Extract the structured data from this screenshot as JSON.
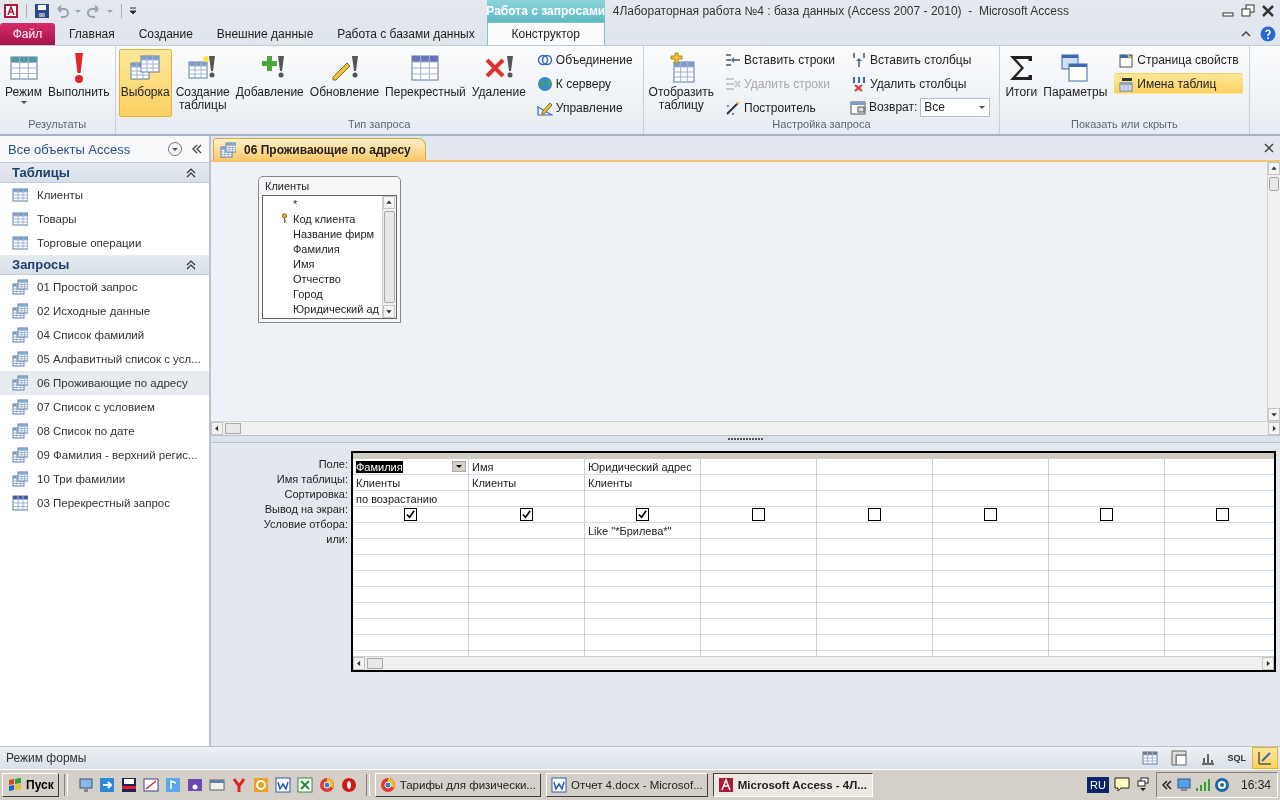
{
  "window": {
    "title": "4Лабораторная работа №4 : база данных (Access 2007 - 2010)  -  Microsoft Access"
  },
  "contextual_tab": "Работа с запросами",
  "tabs": [
    {
      "label": "Файл",
      "kind": "file",
      "selected": false
    },
    {
      "label": "Главная",
      "kind": "normal",
      "selected": false
    },
    {
      "label": "Создание",
      "kind": "normal",
      "selected": false
    },
    {
      "label": "Внешние данные",
      "kind": "normal",
      "selected": false
    },
    {
      "label": "Работа с базами данных",
      "kind": "normal",
      "selected": false
    },
    {
      "label": "Конструктор",
      "kind": "contextual",
      "selected": true
    }
  ],
  "ribbon_groups": [
    {
      "label": "Результаты",
      "columns": [
        [
          {
            "label": "Режим",
            "kind": "large",
            "menu": true,
            "selected": false
          }
        ],
        [
          {
            "label": "Выполнить",
            "kind": "large",
            "selected": false
          }
        ]
      ]
    },
    {
      "label": "Тип запроса",
      "columns": [
        [
          {
            "label": "Выборка",
            "kind": "large",
            "selected": true
          }
        ],
        [
          {
            "label": "Создание\nтаблицы",
            "kind": "large",
            "selected": false
          }
        ],
        [
          {
            "label": "Добавление",
            "kind": "large",
            "selected": false
          }
        ],
        [
          {
            "label": "Обновление",
            "kind": "large",
            "selected": false
          }
        ],
        [
          {
            "label": "Перекрестный",
            "kind": "large",
            "selected": false
          }
        ],
        [
          {
            "label": "Удаление",
            "kind": "large",
            "selected": false
          }
        ],
        [
          {
            "label": "Объединение",
            "kind": "small",
            "selected": false,
            "disabled": false
          },
          {
            "label": "К серверу",
            "kind": "small",
            "selected": false,
            "disabled": false
          },
          {
            "label": "Управление",
            "kind": "small",
            "selected": false,
            "disabled": false
          }
        ]
      ]
    },
    {
      "label": "Настройка запроса",
      "columns": [
        [
          {
            "label": "Отобразить\nтаблицу",
            "kind": "large",
            "selected": false
          }
        ],
        [
          {
            "label": "Вставить строки",
            "kind": "small",
            "selected": false,
            "disabled": false
          },
          {
            "label": "Удалить строки",
            "kind": "small",
            "selected": false,
            "disabled": true
          },
          {
            "label": "Построитель",
            "kind": "small",
            "selected": false,
            "disabled": false
          }
        ],
        [
          {
            "label": "Вставить столбцы",
            "kind": "small",
            "selected": false,
            "disabled": false
          },
          {
            "label": "Удалить столбцы",
            "kind": "small",
            "selected": false,
            "disabled": false
          },
          {
            "label": "Возврат:",
            "kind": "combo",
            "value": "Все"
          }
        ]
      ]
    },
    {
      "label": "Показать или скрыть",
      "columns": [
        [
          {
            "label": "Итоги",
            "kind": "large",
            "selected": false
          }
        ],
        [
          {
            "label": "Параметры",
            "kind": "large",
            "selected": false
          }
        ],
        [
          {
            "label": "Страница свойств",
            "kind": "small",
            "selected": false,
            "disabled": false
          },
          {
            "label": "Имена таблиц",
            "kind": "small",
            "selected": true,
            "disabled": false
          }
        ]
      ]
    }
  ],
  "navigation": {
    "title": "Все объекты Access",
    "sections": [
      {
        "title": "Таблицы",
        "expanded": true,
        "items": [
          {
            "label": "Клиенты",
            "kind": "table",
            "selected": false
          },
          {
            "label": "Товары",
            "kind": "table",
            "selected": false
          },
          {
            "label": "Торговые операции",
            "kind": "table",
            "selected": false
          }
        ]
      },
      {
        "title": "Запросы",
        "expanded": true,
        "items": [
          {
            "label": "01 Простой запрос",
            "kind": "query",
            "selected": false
          },
          {
            "label": "02 Исходные данные",
            "kind": "query",
            "selected": false
          },
          {
            "label": "04 Список фамилий",
            "kind": "query",
            "selected": false
          },
          {
            "label": "05 Алфавитный список с усл...",
            "kind": "query",
            "selected": false
          },
          {
            "label": "06 Проживающие по адресу",
            "kind": "query",
            "selected": true
          },
          {
            "label": "07 Список с условием",
            "kind": "query",
            "selected": false
          },
          {
            "label": "08 Список по дате",
            "kind": "query",
            "selected": false
          },
          {
            "label": "09 Фамилия - верхний регис...",
            "kind": "query",
            "selected": false
          },
          {
            "label": "10 Три фамилии",
            "kind": "query",
            "selected": false
          },
          {
            "label": "03 Перекрестный запрос",
            "kind": "crosstab",
            "selected": false
          }
        ]
      }
    ]
  },
  "document_tab": "06 Проживающие по адресу",
  "table_box": {
    "title": "Клиенты",
    "fields": [
      {
        "label": "*",
        "key": false
      },
      {
        "label": "Код клиента",
        "key": true
      },
      {
        "label": "Название фирм",
        "key": false
      },
      {
        "label": "Фамилия",
        "key": false
      },
      {
        "label": "Имя",
        "key": false
      },
      {
        "label": "Отчество",
        "key": false
      },
      {
        "label": "Город",
        "key": false
      },
      {
        "label": "Юридический ад",
        "key": false
      }
    ]
  },
  "grid": {
    "row_labels": [
      "Поле:",
      "Имя таблицы:",
      "Сортировка:",
      "Вывод на экран:",
      "Условие отбора:",
      "или:"
    ],
    "columns": [
      {
        "field": "Фамилия",
        "table": "Клиенты",
        "sort": "по возрастанию",
        "show": true,
        "selected": true
      },
      {
        "field": "Имя",
        "table": "Клиенты",
        "show": true,
        "selected": false
      },
      {
        "field": "Юридический адрес",
        "table": "Клиенты",
        "show": true,
        "criteria": "Like \"*Брилева*\"",
        "selected": false
      },
      {
        "show": false,
        "selected": false
      },
      {
        "show": false,
        "selected": false
      },
      {
        "show": false,
        "selected": false
      },
      {
        "show": false,
        "selected": false
      },
      {
        "show": false,
        "selected": false
      }
    ]
  },
  "status_bar": {
    "text": "Режим формы",
    "views": [
      {
        "kind": "datasheet",
        "selected": false
      },
      {
        "kind": "pivot_table",
        "selected": false
      },
      {
        "kind": "pivot_chart",
        "selected": false
      },
      {
        "kind": "sql",
        "label": "SQL",
        "selected": false
      },
      {
        "kind": "design",
        "selected": true
      }
    ]
  },
  "taskbar": {
    "start": "Пуск",
    "tasks": [
      {
        "label": "Тарифы для физически...",
        "selected": false
      },
      {
        "label": "Отчет 4.docx - Microsof...",
        "selected": false
      },
      {
        "label": "Microsoft Access - 4Л...",
        "selected": true
      }
    ],
    "language": "RU",
    "clock": "16:34"
  }
}
